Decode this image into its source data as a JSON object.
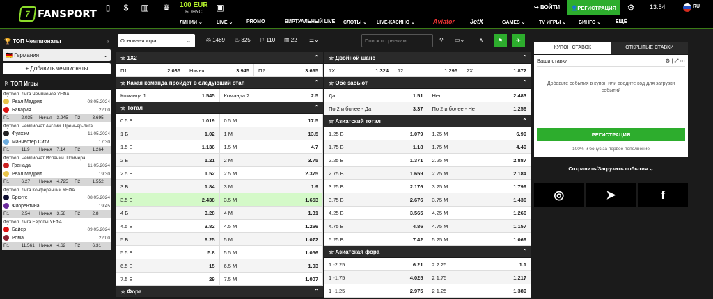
{
  "header": {
    "logo": "FANSPORT",
    "bonus_amount": "100 EUR",
    "bonus_label": "БОНУС",
    "login": "ВОЙТИ",
    "register": "РЕГИСТРАЦИЯ",
    "time": "13:54",
    "lang": "RU"
  },
  "nav": [
    "ЛИНИИ",
    "LIVE",
    "PROMO",
    "ВИРТУАЛЬНЫЙ LIVE",
    "СЛОТЫ",
    "LIVE-КАЗИНО",
    "Aviator",
    "JetX",
    "GAMES",
    "TV ИГРЫ",
    "БИНГО",
    "ЕЩЁ"
  ],
  "sidebar": {
    "champ_title": "ТОП Чемпионаты",
    "country": "Германия",
    "add": "Добавить чемпионаты",
    "games_title": "ТОП Игры",
    "games": [
      {
        "league": "Футбол. Лига Чемпионов УЕФА",
        "t1": "Реал Мадрид",
        "t2": "Бавария",
        "date": "08.05.2024",
        "time": "22:00",
        "c1": "#e9c54a",
        "c2": "#d11",
        "o": [
          "П1",
          "2.035",
          "Ничья",
          "3.945",
          "П2",
          "3.695"
        ]
      },
      {
        "league": "Футбол. Чемпионат Англии. Премьер-лига",
        "t1": "Фулхэм",
        "t2": "Манчестер Сити",
        "date": "11.05.2024",
        "time": "17:30",
        "c1": "#222",
        "c2": "#6cabdd",
        "o": [
          "П1",
          "11.9",
          "Ничья",
          "7.14",
          "П2",
          "1.264"
        ]
      },
      {
        "league": "Футбол. Чемпионат Испании. Примера",
        "t1": "Гранада",
        "t2": "Реал Мадрид",
        "date": "11.05.2024",
        "time": "19:30",
        "c1": "#c22",
        "c2": "#e9c54a",
        "o": [
          "П1",
          "6.27",
          "Ничья",
          "4.725",
          "П2",
          "1.552"
        ]
      },
      {
        "league": "Футбол. Лига Конференций УЕФА",
        "t1": "Брюгге",
        "t2": "Фиорентина",
        "date": "08.05.2024",
        "time": "19:45",
        "c1": "#113",
        "c2": "#6b2a9c",
        "o": [
          "П1",
          "2.54",
          "Ничья",
          "3.58",
          "П2",
          "2.8"
        ]
      },
      {
        "league": "Футбол. Лига Европы УЕФА",
        "t1": "Байер",
        "t2": "Рома",
        "date": "09.05.2024",
        "time": "22:00",
        "c1": "#d11",
        "c2": "#8e1f2f",
        "o": [
          "П1",
          "11.561",
          "Ничья",
          "4.62",
          "П2",
          "6.31"
        ]
      }
    ]
  },
  "filters": {
    "main": "Основная игра",
    "c1": "1489",
    "c2": "325",
    "c3": "110",
    "c4": "22",
    "search": "Поиск по рынкам"
  },
  "left_markets": [
    {
      "title": "1X2",
      "rows": [
        [
          [
            "П1",
            "2.035"
          ],
          [
            "Ничья",
            "3.945"
          ],
          [
            "П2",
            "3.695"
          ]
        ]
      ]
    },
    {
      "title": "Какая команда пройдет в следующий этап",
      "rows": [
        [
          [
            "Команда 1",
            "1.545"
          ],
          [
            "Команда 2",
            "2.5"
          ]
        ]
      ]
    },
    {
      "title": "Тотал",
      "rows": [
        [
          [
            "0.5 Б",
            "1.019"
          ],
          [
            "0.5 М",
            "17.5"
          ]
        ],
        [
          [
            "1 Б",
            "1.02"
          ],
          [
            "1 М",
            "13.5"
          ]
        ],
        [
          [
            "1.5 Б",
            "1.136"
          ],
          [
            "1.5 М",
            "4.7"
          ]
        ],
        [
          [
            "2 Б",
            "1.21"
          ],
          [
            "2 М",
            "3.75"
          ]
        ],
        [
          [
            "2.5 Б",
            "1.52"
          ],
          [
            "2.5 М",
            "2.375"
          ]
        ],
        [
          [
            "3 Б",
            "1.84"
          ],
          [
            "3 М",
            "1.9"
          ]
        ],
        [
          [
            "3.5 Б",
            "2.438"
          ],
          [
            "3.5 М",
            "1.653"
          ]
        ],
        [
          [
            "4 Б",
            "3.28"
          ],
          [
            "4 М",
            "1.31"
          ]
        ],
        [
          [
            "4.5 Б",
            "3.82"
          ],
          [
            "4.5 М",
            "1.266"
          ]
        ],
        [
          [
            "5 Б",
            "6.25"
          ],
          [
            "5 М",
            "1.072"
          ]
        ],
        [
          [
            "5.5 Б",
            "5.8"
          ],
          [
            "5.5 М",
            "1.056"
          ]
        ],
        [
          [
            "6.5 Б",
            "15"
          ],
          [
            "6.5 М",
            "1.03"
          ]
        ],
        [
          [
            "7.5 Б",
            "29"
          ],
          [
            "7.5 М",
            "1.007"
          ]
        ]
      ]
    },
    {
      "title": "Фора",
      "rows": []
    }
  ],
  "right_markets": [
    {
      "title": "Двойной шанс",
      "rows": [
        [
          [
            "1X",
            "1.324"
          ],
          [
            "12",
            "1.295"
          ],
          [
            "2X",
            "1.872"
          ]
        ]
      ]
    },
    {
      "title": "Обе забьют",
      "rows": [
        [
          [
            "Да",
            "1.51"
          ],
          [
            "Нет",
            "2.483"
          ]
        ],
        [
          [
            "По 2 и более - Да",
            "3.37"
          ],
          [
            "По 2 и более - Нет",
            "1.256"
          ]
        ]
      ]
    },
    {
      "title": "Азиатский тотал",
      "rows": [
        [
          [
            "1.25 Б",
            "1.079"
          ],
          [
            "1.25 М",
            "6.99"
          ]
        ],
        [
          [
            "1.75 Б",
            "1.18"
          ],
          [
            "1.75 М",
            "4.49"
          ]
        ],
        [
          [
            "2.25 Б",
            "1.371"
          ],
          [
            "2.25 М",
            "2.887"
          ]
        ],
        [
          [
            "2.75 Б",
            "1.659"
          ],
          [
            "2.75 М",
            "2.184"
          ]
        ],
        [
          [
            "3.25 Б",
            "2.176"
          ],
          [
            "3.25 М",
            "1.799"
          ]
        ],
        [
          [
            "3.75 Б",
            "2.676"
          ],
          [
            "3.75 М",
            "1.436"
          ]
        ],
        [
          [
            "4.25 Б",
            "3.565"
          ],
          [
            "4.25 М",
            "1.266"
          ]
        ],
        [
          [
            "4.75 Б",
            "4.86"
          ],
          [
            "4.75 М",
            "1.157"
          ]
        ],
        [
          [
            "5.25 Б",
            "7.42"
          ],
          [
            "5.25 М",
            "1.069"
          ]
        ]
      ]
    },
    {
      "title": "Азиатская фора",
      "rows": [
        [
          [
            "1 -2.25",
            "6.21"
          ],
          [
            "2 2.25",
            "1.1"
          ]
        ],
        [
          [
            "1 -1.75",
            "4.025"
          ],
          [
            "2 1.75",
            "1.217"
          ]
        ],
        [
          [
            "1 -1.25",
            "2.975"
          ],
          [
            "2 1.25",
            "1.389"
          ]
        ]
      ]
    }
  ],
  "right": {
    "tab1": "КУПОН СТАВОК",
    "tab2": "ОТКРЫТЫЕ СТАВКИ",
    "bets": "Ваши ставки",
    "msg": "Добавьте события в купон или введите код для загрузки событий",
    "reg": "РЕГИСТРАЦИЯ",
    "bonus": "100%-й бонус за первое пополнение",
    "save": "Сохранить/Загрузить события"
  }
}
